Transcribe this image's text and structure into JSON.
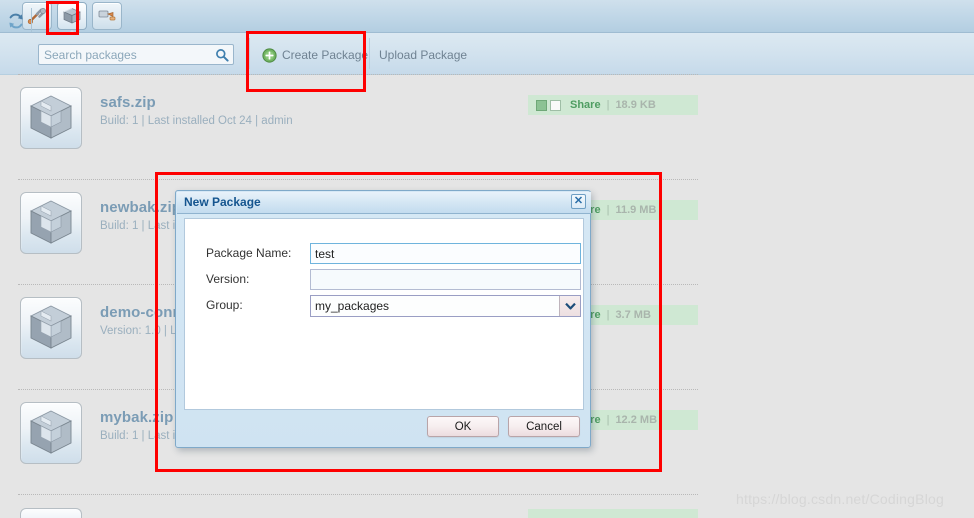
{
  "window": {
    "tabs": [
      {
        "name": "tools-tab",
        "icon": "wrench-icon",
        "selected": false
      },
      {
        "name": "packages-tab",
        "icon": "package-box-icon",
        "selected": true
      },
      {
        "name": "paint-tab",
        "icon": "paint-roller-icon",
        "selected": false
      }
    ]
  },
  "actionbar": {
    "refresh_icon": "refresh-icon",
    "search": {
      "placeholder": "Search packages",
      "value": "",
      "icon": "magnifier-icon"
    },
    "create_label": "Create Package",
    "create_icon": "plus-circle-icon",
    "upload_label": "Upload Package"
  },
  "packages": [
    {
      "name": "safs.zip",
      "meta": "Build: 1 | Last installed Oct 24 | admin",
      "share_label": "Share",
      "size": "18.9 KB",
      "checkbox_left": true,
      "checkbox_right": false
    },
    {
      "name": "newbak.zip",
      "meta": "Build: 1 | Last installed Oct 24 | admin",
      "share_label": "Share",
      "size": "11.9 MB",
      "checkbox_left": true,
      "checkbox_right": false
    },
    {
      "name": "demo-connector.zip",
      "meta": "Version: 1.0 | Last installed Oct 24 | admin",
      "share_label": "Share",
      "size": "3.7 MB",
      "checkbox_left": true,
      "checkbox_right": false
    },
    {
      "name": "mybak.zip",
      "meta": "Build: 1 | Last installed Oct 24 | admin",
      "share_label": "Share",
      "size": "12.2 MB",
      "checkbox_left": true,
      "checkbox_right": false
    }
  ],
  "dialog": {
    "title": "New Package",
    "close_icon": "close-icon",
    "fields": {
      "package_name": {
        "label": "Package Name:",
        "value": "test",
        "placeholder": ""
      },
      "version": {
        "label": "Version:",
        "value": "",
        "placeholder": ""
      },
      "group": {
        "label": "Group:",
        "value": "my_packages",
        "arrow_icon": "chevron-down-icon"
      }
    },
    "ok_label": "OK",
    "cancel_label": "Cancel"
  },
  "annotations": {
    "accent_color": "#fe0000",
    "boxes": [
      "packages-tab-highlight",
      "create-package-highlight",
      "new-package-dialog-highlight"
    ]
  },
  "watermark": "https://blog.csdn.net/CodingBlog",
  "colors": {
    "chrome_top": "#c2d8e8",
    "actionbar": "#d2e2ee",
    "page_bg": "#e5e5e5",
    "badge_bg": "#cfe8d3",
    "share_green": "#4f9d62",
    "pkg_name_blue": "#7b9cb5",
    "dialog_title_blue": "#15558f"
  }
}
